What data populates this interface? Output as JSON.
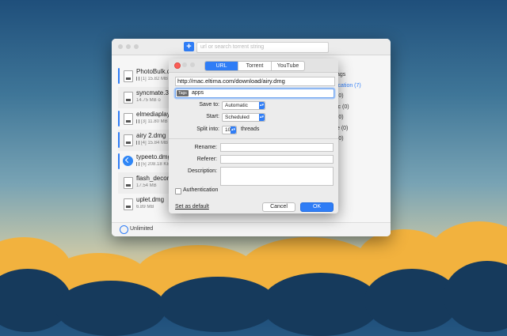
{
  "toolbar": {
    "add_label": "+",
    "url_placeholder": "url or search torrent string"
  },
  "downloads": [
    {
      "name": "PhotoBulk.dmg",
      "meta": "[1] 15.82 MB o",
      "icon": "disk-image-icon",
      "active": true
    },
    {
      "name": "syncmate.3.dmg",
      "meta": "14.75 MB o",
      "icon": "disk-image-icon",
      "active": false
    },
    {
      "name": "elmediaplayer.dmg",
      "meta": "[3] 11.80 MB o",
      "icon": "disk-image-icon",
      "active": true
    },
    {
      "name": "airy 2.dmg",
      "meta": "[4] 15.84 MB o",
      "icon": "disk-image-icon",
      "active": true
    },
    {
      "name": "typeeto.dmg",
      "meta": "[5] 208.18 KB o",
      "icon": "app-icon",
      "active": true
    },
    {
      "name": "flash_decompiler",
      "meta": "17.54 MB",
      "icon": "document-icon",
      "active": false
    },
    {
      "name": "uplet.dmg",
      "meta": "6.89 MB",
      "icon": "document-icon",
      "active": false
    }
  ],
  "tags_panel": {
    "header": "ags",
    "items": [
      "ication (7)",
      "(0)",
      "ic (0)",
      "(0)",
      "e (0)",
      "(0)"
    ]
  },
  "status": {
    "speed_label": "Unlimited"
  },
  "dialog": {
    "tabs": [
      "URL",
      "Torrent",
      "YouTube"
    ],
    "active_tab": "URL",
    "url_value": "http://mac.eltima.com/download/airy.dmg",
    "tag_icon": "Tags",
    "tag_value": "apps",
    "save_to_label": "Save to:",
    "save_to_value": "Automatic",
    "start_label": "Start:",
    "start_value": "Scheduled",
    "split_label": "Split into:",
    "split_value": "10",
    "split_unit": "threads",
    "rename_label": "Rename:",
    "referer_label": "Referer:",
    "description_label": "Description:",
    "auth_label": "Authentication",
    "set_default_label": "Set as default",
    "cancel_label": "Cancel",
    "ok_label": "OK"
  }
}
